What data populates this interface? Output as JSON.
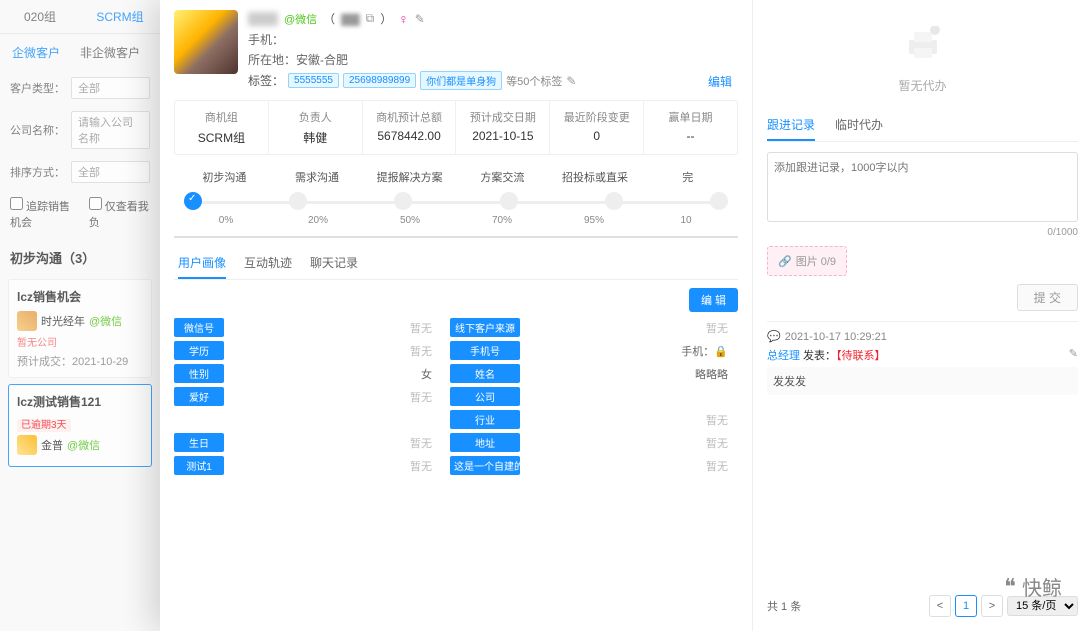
{
  "left": {
    "groups": {
      "a": "020组",
      "b": "SCRM组"
    },
    "sub": {
      "a": "企微客户",
      "b": "非企微客户"
    },
    "filters": {
      "type_lab": "客户类型：",
      "type_val": "全部",
      "company_lab": "公司名称：",
      "company_ph": "请输入公司名称",
      "sort_lab": "排序方式：",
      "sort_val": "全部"
    },
    "chk": {
      "a": "追踪销售机会",
      "b": "仅查看我负"
    },
    "section": "初步沟通（3）",
    "cards": {
      "c1": {
        "title": "lcz销售机会",
        "name": "时光经年",
        "wx": "@微信",
        "org": "暂无公司",
        "date": "预计成交：2021-10-29"
      },
      "c2": {
        "title": "lcz测试销售121",
        "overdue": "已逾期3天",
        "name": "金普",
        "wx": "@微信"
      }
    }
  },
  "profile": {
    "wx_tag": "@微信",
    "gender_text": "♀",
    "phone_lab": "手机：",
    "loc_lab": "所在地：",
    "loc_val": "安徽-合肥",
    "tag_lab": "标签：",
    "tags": {
      "t1": "5555555",
      "t2": "25698989899",
      "t3": "你们都是单身狗"
    },
    "tag_more": "等50个标签",
    "edit_pen": "✎",
    "edit_link": "编辑"
  },
  "stats": {
    "h1": "商机组",
    "v1": "SCRM组",
    "h2": "负责人",
    "v2": "韩健",
    "h3": "商机预计总额",
    "v3": "5678442.00",
    "h4": "预计成交日期",
    "v4": "2021-10-15",
    "h5": "最近阶段变更",
    "v5": "0",
    "h6": "赢单日期",
    "v6": "--"
  },
  "stages": {
    "labels": {
      "s1": "初步沟通",
      "s2": "需求沟通",
      "s3": "提报解决方案",
      "s4": "方案交流",
      "s5": "招投标或直采",
      "s6": "完"
    },
    "pcts": {
      "p1": "0%",
      "p2": "20%",
      "p3": "50%",
      "p4": "70%",
      "p5": "95%",
      "p6": "10"
    }
  },
  "dtabs": {
    "a": "用户画像",
    "b": "互动轨迹",
    "c": "聊天记录"
  },
  "edit_btn": "编 辑",
  "fields": {
    "l1": "微信号",
    "v1": "暂无",
    "l7": "线下客户来源",
    "v7": "暂无",
    "l2": "学历",
    "v2": "暂无",
    "l8": "手机号",
    "v8l": "手机：",
    "v8": "",
    "l3": "性别",
    "v3": "女",
    "l9": "姓名",
    "v9": "略略略",
    "l4": "爱好",
    "v4": "暂无",
    "l10": "公司",
    "v10": "",
    "blank": "",
    "empty": "",
    "l11": "行业",
    "v11": "暂无",
    "l5": "生日",
    "v5": "暂无",
    "l12": "地址",
    "v12": "暂无",
    "l6": "测试1",
    "v6": "暂无",
    "l13": "这是一个自建的图",
    "v13": "暂无"
  },
  "right": {
    "empty": "暂无代办",
    "tabs": {
      "a": "跟进记录",
      "b": "临时代办"
    },
    "ta_ph": "添加跟进记录，1000字以内",
    "count": "0/1000",
    "img_up": "图片 0/9",
    "submit": "提 交",
    "log": {
      "time": "2021-10-17 10:29:21",
      "role": "总经理",
      "say": " 发表：",
      "status": "【待联系】",
      "content": "发发发"
    },
    "pager": {
      "total": "共 1 条",
      "page": "1",
      "per": "15 条/页"
    }
  },
  "watermark": "快鲸"
}
